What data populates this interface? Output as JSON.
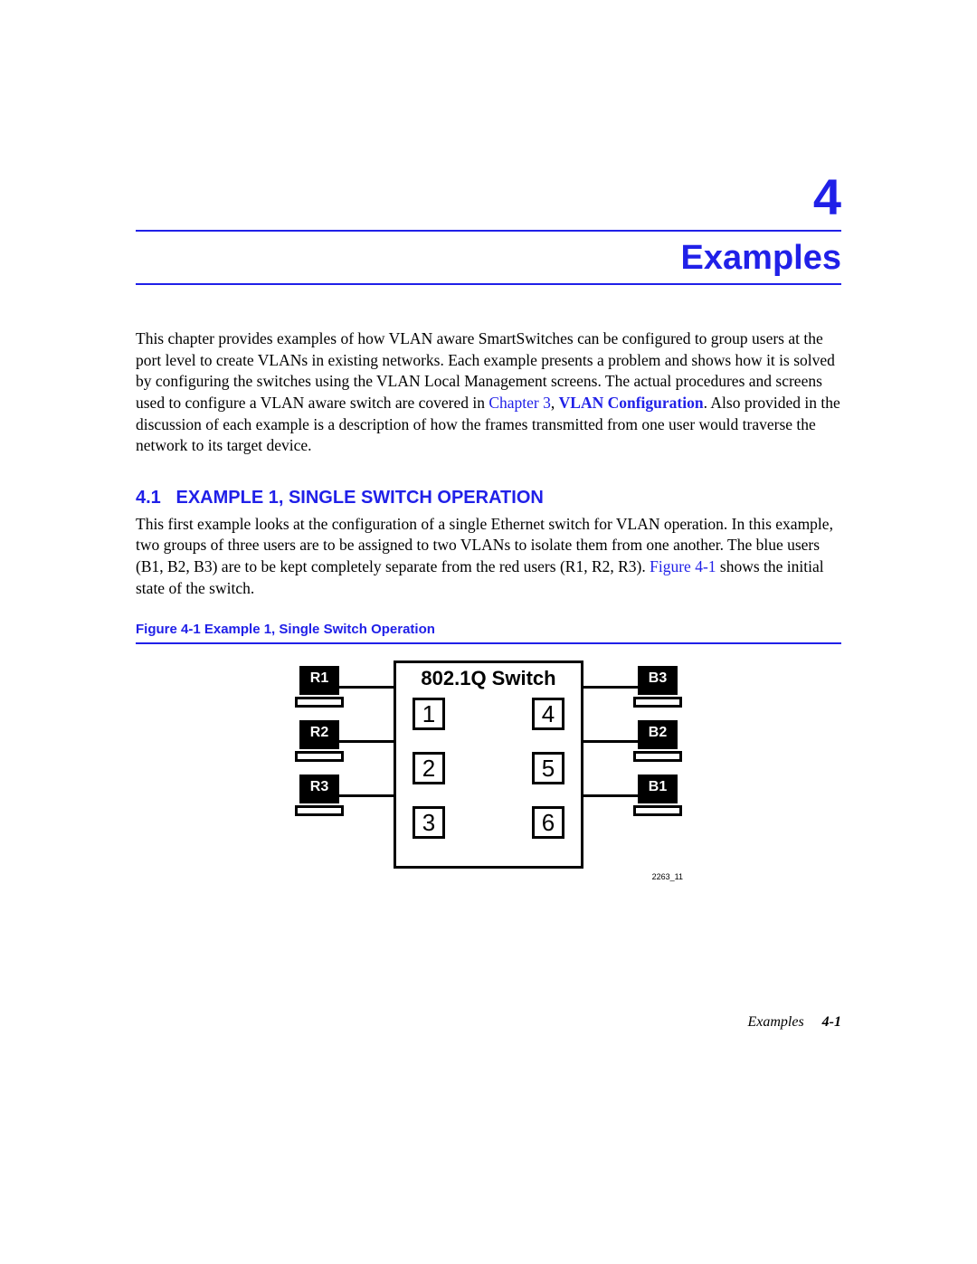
{
  "chapter": {
    "number": "4",
    "title": "Examples"
  },
  "intro": {
    "text_before_link": "This chapter provides examples of how VLAN aware SmartSwitches can be configured to group users at the port level to create VLANs in existing networks. Each example presents a problem and shows how it is solved by configuring the switches using the VLAN Local Management screens. The actual procedures and screens used to configure a VLAN aware switch are covered in ",
    "link1_a": "Chapter 3",
    "link_sep": ", ",
    "link1_b": "VLAN Configuration",
    "text_after_link": ". Also provided in the discussion of each example is a description of how the frames transmitted from one user would traverse the network to its target device."
  },
  "section": {
    "number": "4.1",
    "title": "EXAMPLE 1, SINGLE SWITCH OPERATION",
    "body_before_fig": "This first example looks at the configuration of a single Ethernet switch for VLAN operation. In this example, two groups of three users are to be assigned to two VLANs to isolate them from one another. The blue users (B1, B2, B3) are to be kept completely separate from the red users (R1, R2, R3). ",
    "figref": "Figure 4-1",
    "body_after_fig": " shows the initial state of the switch."
  },
  "figure": {
    "caption": "Figure 4-1   Example 1, Single Switch Operation",
    "switch_title": "802.1Q Switch",
    "ports": {
      "p1": "1",
      "p2": "2",
      "p3": "3",
      "p4": "4",
      "p5": "5",
      "p6": "6"
    },
    "left": {
      "top": "R1",
      "mid": "R2",
      "bot": "R3"
    },
    "right": {
      "top": "B3",
      "mid": "B2",
      "bot": "B1"
    },
    "id": "2263_11"
  },
  "footer": {
    "chapter": "Examples",
    "page": "4-1"
  }
}
